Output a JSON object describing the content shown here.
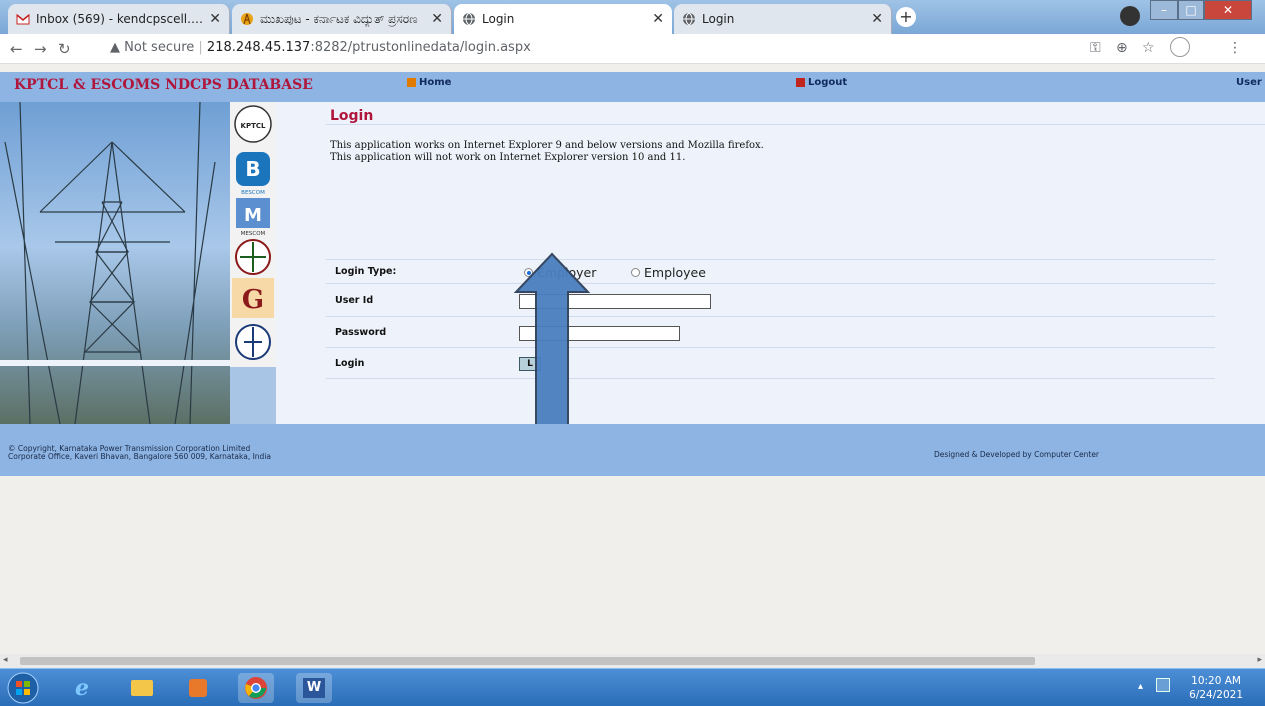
{
  "tabs": [
    {
      "title": "Inbox (569) - kendcpscell.kptcl@",
      "active": false,
      "icon": "gmail-icon"
    },
    {
      "title": "ಮುಖಪುಟ - ಕರ್ನಾಟಕ ವಿದ್ಯುತ್ ಪ್ರಸರಣ",
      "active": false,
      "icon": "kptcl-icon"
    },
    {
      "title": "Login",
      "active": true,
      "icon": "globe-icon"
    },
    {
      "title": "Login",
      "active": false,
      "icon": "globe-icon"
    }
  ],
  "addressbar": {
    "security": "Not secure",
    "url_host": "218.248.45.137",
    "url_rest": ":8282/ptrustonlinedata/login.aspx"
  },
  "site": {
    "title": "KPTCL & ESCOMS NDCPS DATABASE",
    "nav": {
      "home": "Home",
      "logout": "Logout",
      "user": "User"
    }
  },
  "login": {
    "heading": "Login",
    "notes": [
      "This application works on Internet Explorer 9 and below versions and Mozilla firefox.",
      "This application will not work on Internet Explorer version 10 and 11."
    ],
    "login_type_label": "Login Type:",
    "login_type_options": [
      "Employer",
      "Employee"
    ],
    "login_type_selected": "Employer",
    "userid_label": "User Id",
    "password_label": "Password",
    "login_label": "Login",
    "login_button": "L"
  },
  "footer": {
    "copyright_line1": "© Copyright,  Karnataka Power Transmission Corporation Limited",
    "copyright_line2": "Corporate Office, Kaveri Bhavan, Bangalore 560 009, Karnataka, India",
    "credit": "Designed & Developed by Computer Center"
  },
  "logos": [
    "KPTCL",
    "BESCOM",
    "MESCOM",
    "CESC",
    "GESCOM",
    "HESCOM"
  ],
  "clock": {
    "time": "10:20 AM",
    "date": "6/24/2021"
  },
  "colors": {
    "accent": "#8db4e2",
    "title_red": "#b0163c",
    "arrow_blue": "#4a7fc0"
  }
}
